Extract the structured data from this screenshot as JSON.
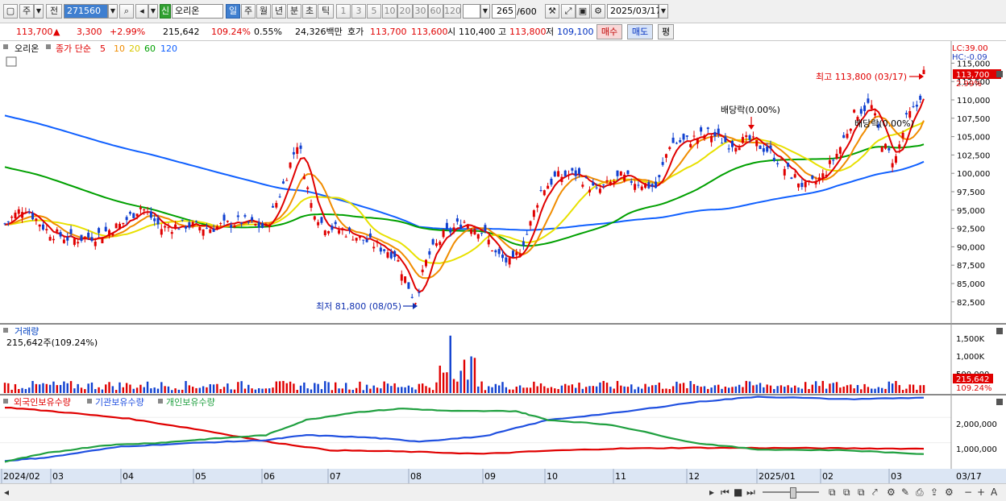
{
  "toolbar": {
    "period_type": "주",
    "prev_label": "전",
    "code": "271560",
    "badge": "신",
    "stock_name": "오리온",
    "tabs": [
      "일",
      "주",
      "월",
      "년",
      "분",
      "초",
      "틱"
    ],
    "selected_tab": "일",
    "intervals": [
      "1",
      "3",
      "5",
      "10",
      "20",
      "30",
      "60",
      "120"
    ],
    "count": "265",
    "count_total": "/600",
    "date": "2025/03/17"
  },
  "quote": {
    "price": "113,700",
    "arrow": "▲",
    "change": "3,300",
    "change_pct": "+2.99%",
    "volume": "215,642",
    "volume_ratio": "109.24%",
    "turnover": "0.55%",
    "amount": "24,326백만",
    "hoga_label": "호가",
    "ask": "113,700",
    "bid": "113,600",
    "open_label": "시",
    "open": "110,400",
    "high_label": "고",
    "high": "113,800",
    "low_label": "저",
    "low": "109,100",
    "buy_btn": "매수",
    "sell_btn": "매도",
    "eval_btn": "평"
  },
  "price_panel": {
    "name_tag": "오리온",
    "legend_prefix": "종가 단순",
    "ma_periods": [
      "5",
      "10",
      "20",
      "60",
      "120"
    ],
    "ma_colors": [
      "#e00000",
      "#f08c00",
      "#e8e000",
      "#00a000",
      "#1060ff"
    ],
    "lc": "LC:39.00",
    "hc": "HC:-0.09",
    "current_price": "113,700",
    "current_pct": "2.99%",
    "y_ticks": [
      "115,000",
      "112,500",
      "110,000",
      "107,500",
      "105,000",
      "102,500",
      "100,000",
      "97,500",
      "95,000",
      "92,500",
      "90,000",
      "87,500",
      "85,000",
      "82,500"
    ],
    "high_annotation": "최고 113,800 (03/17)",
    "low_annotation": "최저 81,800 (08/05)",
    "dividend_1": "배당락(0.00%)",
    "dividend_2": "배당락(0.00%)"
  },
  "volume_panel": {
    "title": "거래량",
    "summary": "215,642주(109.24%)",
    "y_ticks": [
      "1,500K",
      "1,000K",
      "500,000"
    ],
    "current": "215,642",
    "current_pct": "109.24%"
  },
  "holdings_panel": {
    "series": [
      "외국인보유수량",
      "기관보유수량",
      "개인보유수량"
    ],
    "series_colors": [
      "#e00000",
      "#2050e0",
      "#20a040"
    ],
    "y_ticks": [
      "2,000,000",
      "1,000,000"
    ]
  },
  "x_axis": {
    "labels": [
      "2024/02",
      "03",
      "04",
      "05",
      "06",
      "07",
      "08",
      "09",
      "10",
      "11",
      "12",
      "2025/01",
      "02",
      "03"
    ],
    "end_label": "03/17"
  },
  "chart_data": {
    "type": "candlestick",
    "symbol": "오리온",
    "period": "daily",
    "x_range": [
      "2024/02",
      "2025/03/17"
    ],
    "price_range": [
      80000,
      116000
    ],
    "last_close": 113700,
    "high": {
      "value": 113800,
      "date": "03/17"
    },
    "low": {
      "value": 81800,
      "date": "08/05"
    },
    "moving_averages": [
      5,
      10,
      20,
      60,
      120
    ],
    "volume_ylim": [
      0,
      1800000
    ],
    "holdings_ylim": [
      0,
      2900000
    ]
  }
}
